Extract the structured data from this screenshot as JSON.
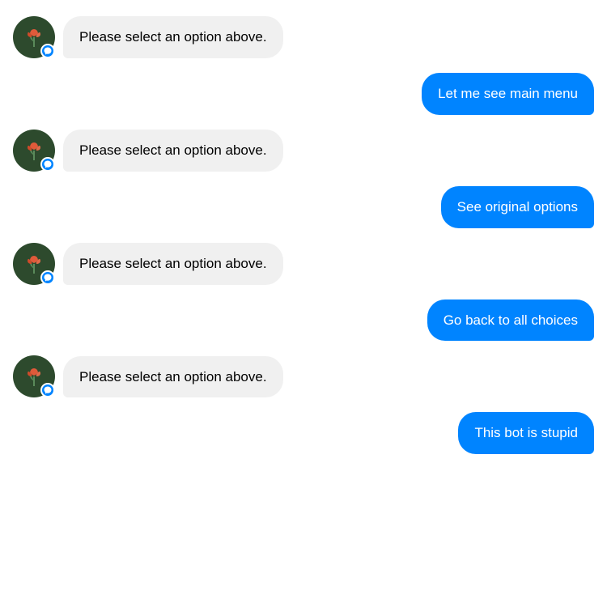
{
  "messages": [
    {
      "id": "msg1",
      "type": "bot",
      "text": "Please select an option above."
    },
    {
      "id": "msg2",
      "type": "user",
      "text": "Let me see main menu"
    },
    {
      "id": "msg3",
      "type": "bot",
      "text": "Please select an option above."
    },
    {
      "id": "msg4",
      "type": "user",
      "text": "See original options"
    },
    {
      "id": "msg5",
      "type": "bot",
      "text": "Please select an option above."
    },
    {
      "id": "msg6",
      "type": "user",
      "text": "Go back to all choices"
    },
    {
      "id": "msg7",
      "type": "bot",
      "text": "Please select an option above."
    },
    {
      "id": "msg8",
      "type": "user",
      "text": "This bot is stupid"
    }
  ],
  "colors": {
    "user_bubble": "#0084ff",
    "bot_bubble": "#f0f0f0",
    "messenger_badge": "#0084ff"
  }
}
